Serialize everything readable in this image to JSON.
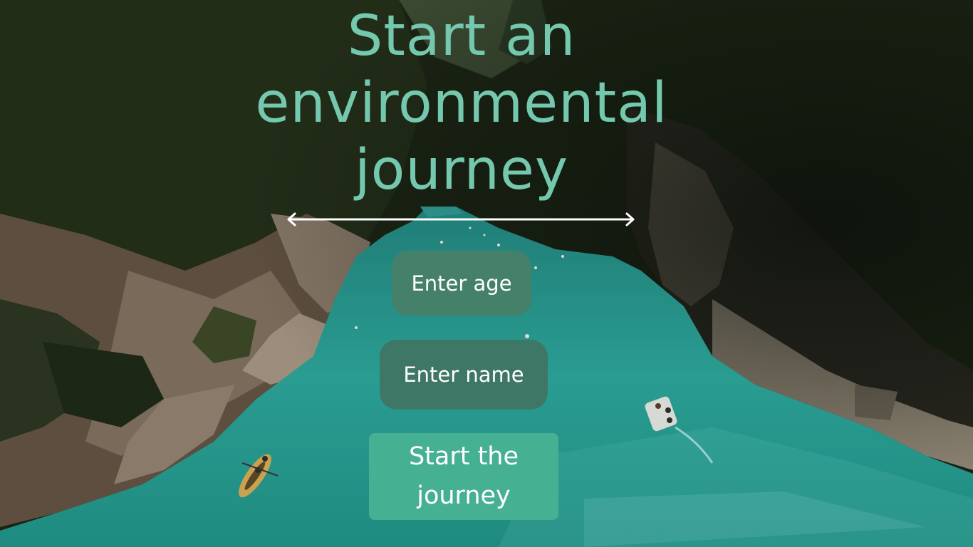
{
  "title": {
    "line1": "Start an",
    "line2": "environmental",
    "line3": "journey"
  },
  "divider": {
    "icon": "double-headed-arrow",
    "color": "#ffffff"
  },
  "form": {
    "age_label": "Enter age",
    "name_label": "Enter name",
    "start_line1": "Start the",
    "start_line2": "journey"
  },
  "background": {
    "subject": "river canyon photograph",
    "water_color": "#2e9e92",
    "forest_color": "#1f2a16"
  },
  "colors": {
    "title": "#74c8ae",
    "age_field": "#44806a",
    "name_field": "#3f7766",
    "start_button": "#46b092"
  }
}
